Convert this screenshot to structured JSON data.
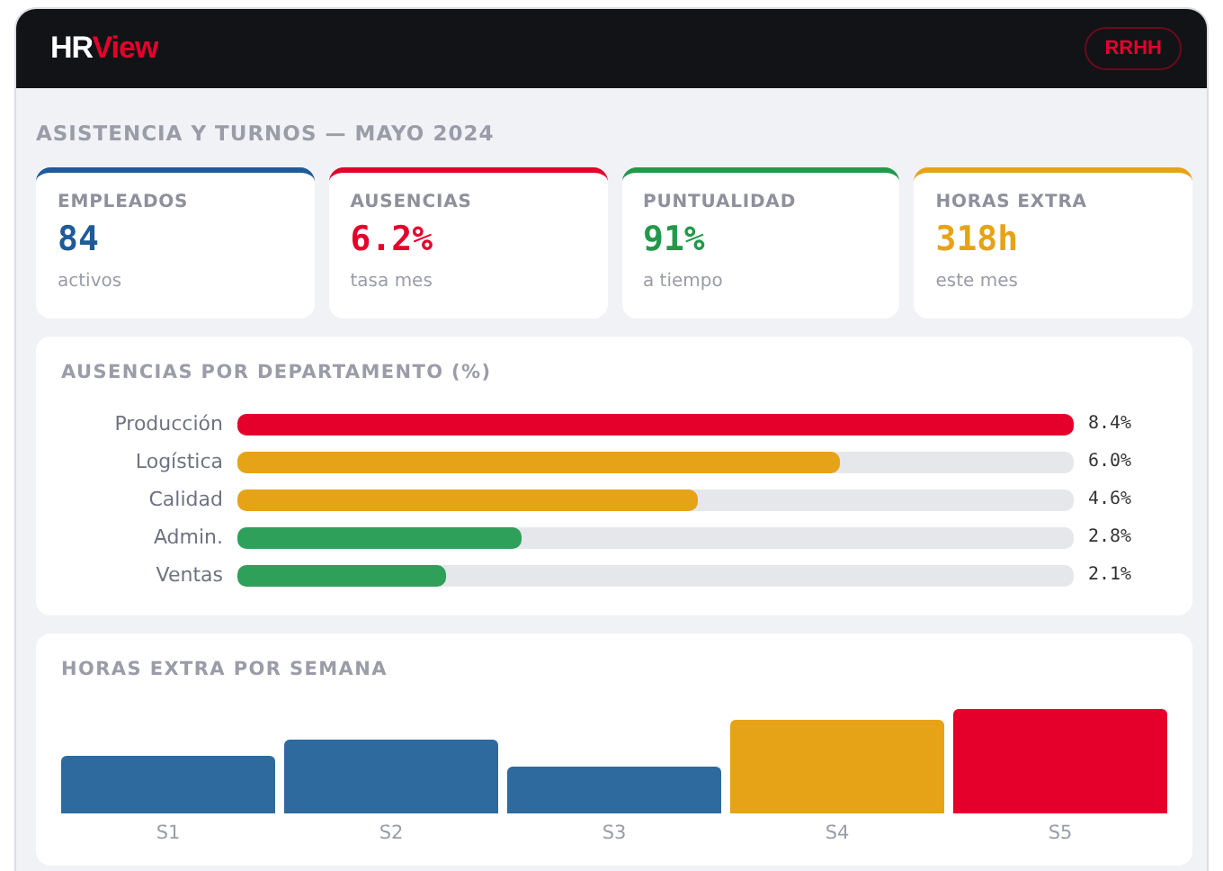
{
  "header": {
    "logo_part_1": "HR",
    "logo_part_2": "View",
    "badge": "RRHH"
  },
  "page_title": "ASISTENCIA Y TURNOS — MAYO 2024",
  "kpis": [
    {
      "label": "EMPLEADOS",
      "value": "84",
      "note": "activos",
      "color": "#1f5b99"
    },
    {
      "label": "AUSENCIAS",
      "value": "6.2%",
      "note": "tasa mes",
      "color": "#e4002b"
    },
    {
      "label": "PUNTUALIDAD",
      "value": "91%",
      "note": "a tiempo",
      "color": "#22994a"
    },
    {
      "label": "HORAS EXTRA",
      "value": "318h",
      "note": "este mes",
      "color": "#e6a317"
    }
  ],
  "departments": {
    "title": "AUSENCIAS POR DEPARTAMENTO (%)",
    "rows": [
      {
        "name": "Producción",
        "level": 1,
        "reading": "8.4%",
        "color": "#e4002b"
      },
      {
        "name": "Logística",
        "level": 0.72,
        "reading": "6.0%",
        "color": "#e6a317"
      },
      {
        "name": "Calidad",
        "level": 0.55,
        "reading": "4.6%",
        "color": "#e6a317"
      },
      {
        "name": "Admin.",
        "level": 0.34,
        "reading": "2.8%",
        "color": "#2ea05a"
      },
      {
        "name": "Ventas",
        "level": 0.25,
        "reading": "2.1%",
        "color": "#2ea05a"
      }
    ]
  },
  "weekly": {
    "title": "HORAS EXTRA POR SEMANA",
    "weeks": [
      {
        "label": "S1",
        "color": "#2e6a9e"
      },
      {
        "label": "S2",
        "color": "#2e6a9e"
      },
      {
        "label": "S3",
        "color": "#2e6a9e"
      },
      {
        "label": "S4",
        "color": "#e6a317"
      },
      {
        "label": "S5",
        "color": "#e4002b"
      }
    ]
  }
}
